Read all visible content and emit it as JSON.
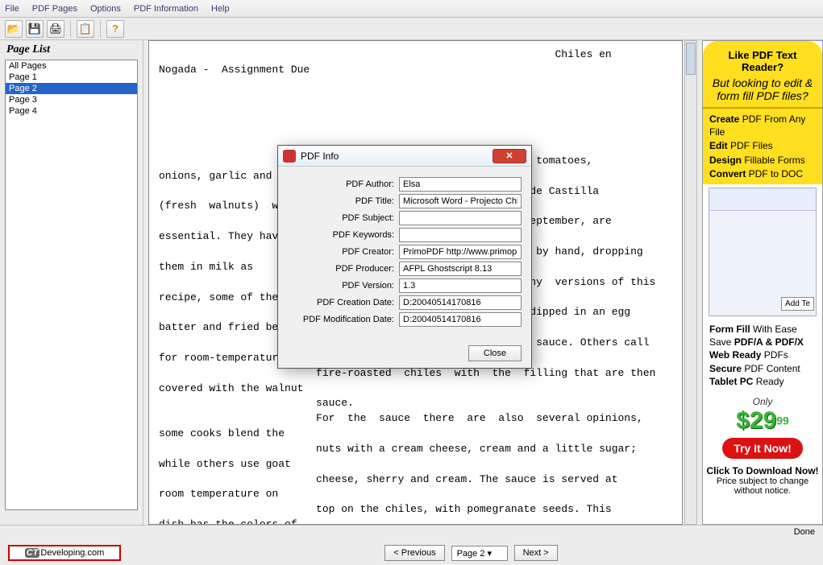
{
  "menu": {
    "file": "File",
    "pages": "PDF Pages",
    "options": "Options",
    "info": "PDF Information",
    "help": "Help"
  },
  "pagelist_title": "Page List",
  "pages": [
    "All Pages",
    "Page 1",
    "Page 2",
    "Page 3",
    "Page 4"
  ],
  "selected_page_idx": 2,
  "doc_text": "                                                               Chiles en\nNogada -  Assignment Due\n\n\n\n\n\n                         olives, minced pork and beef meat, tomatoes,\nonions, garlic and herbs.\n                         For  making  the  sauce,  nueces  de Castilla\n(fresh  walnuts)  which\n                         are  available  in  August  and  September, are\nessential. They have  to\n                         be  finely  ground,  often  peeled by hand, dropping\nthem in milk as\n                         they  are  peeled.  There  are  many  versions of this\nrecipe, some of the\n                         chiles  are  then  battered  and  dipped in an egg\nbatter and fried before\n                         covering  them  with  the  walnut  sauce. Others call\nfor room-temperature,\n                         fire-roasted  chiles  with  the  filling that are then\ncovered with the walnut\n                         sauce.\n                         For  the  sauce  there  are  also  several opinions,\nsome cooks blend the\n                         nuts with a cream cheese, cream and a little sugar;\nwhile others use goat\n                         cheese, sherry and cream. The sauce is served at\nroom temperature on\n                         top on the chiles, with pomegranate seeds. This\ndish has the colors of\n                         the Mexican flag, the green chilies, the white\nluscious nut cream and the\n                         pomegranate are a clear reminder of Mexican\nnational feelings.",
  "status": "Done",
  "nav": {
    "prev": "< Previous",
    "next": "Next >",
    "current": "Page 2"
  },
  "dialog": {
    "title": "PDF Info",
    "fields": {
      "author_l": "PDF Author:",
      "author_v": "Elsa",
      "title_l": "PDF Title:",
      "title_v": "Microsoft Word - Projecto Chi",
      "subject_l": "PDF Subject:",
      "subject_v": "",
      "keywords_l": "PDF Keywords:",
      "keywords_v": "",
      "creator_l": "PDF Creator:",
      "creator_v": "PrimoPDF http://www.primop",
      "producer_l": "PDF Producer:",
      "producer_v": "AFPL Ghostscript 8.13",
      "version_l": "PDF Version:",
      "version_v": "1.3",
      "created_l": "PDF Creation Date:",
      "created_v": "D:20040514170816",
      "modified_l": "PDF Modification Date:",
      "modified_v": "D:20040514170816"
    },
    "close": "Close"
  },
  "ad": {
    "q": "Like PDF Text Reader?",
    "sub": "But looking to edit & form fill PDF files?",
    "f1a": "Create",
    "f1b": " PDF From Any File",
    "f2a": "Edit",
    "f2b": " PDF Files",
    "f3a": "Design",
    "f3b": " Fillable Forms",
    "f4a": "Convert",
    "f4b": " PDF to DOC",
    "addtext": "Add Te",
    "b1a": "Form Fill",
    "b1b": " With Ease",
    "b2a": "Save ",
    "b2b": "PDF/A & PDF/X",
    "b3a": "Web Ready",
    "b3b": " PDFs",
    "b4a": "Secure",
    "b4b": " PDF Content",
    "b5a": "Tablet PC",
    "b5b": " Ready",
    "only": "Only",
    "price": "$29",
    "cents": "99",
    "try": "Try It Now!",
    "dl": "Click To Download Now!",
    "disclaimer": "Price subject to change without notice."
  },
  "ctdev": "Developing.com"
}
